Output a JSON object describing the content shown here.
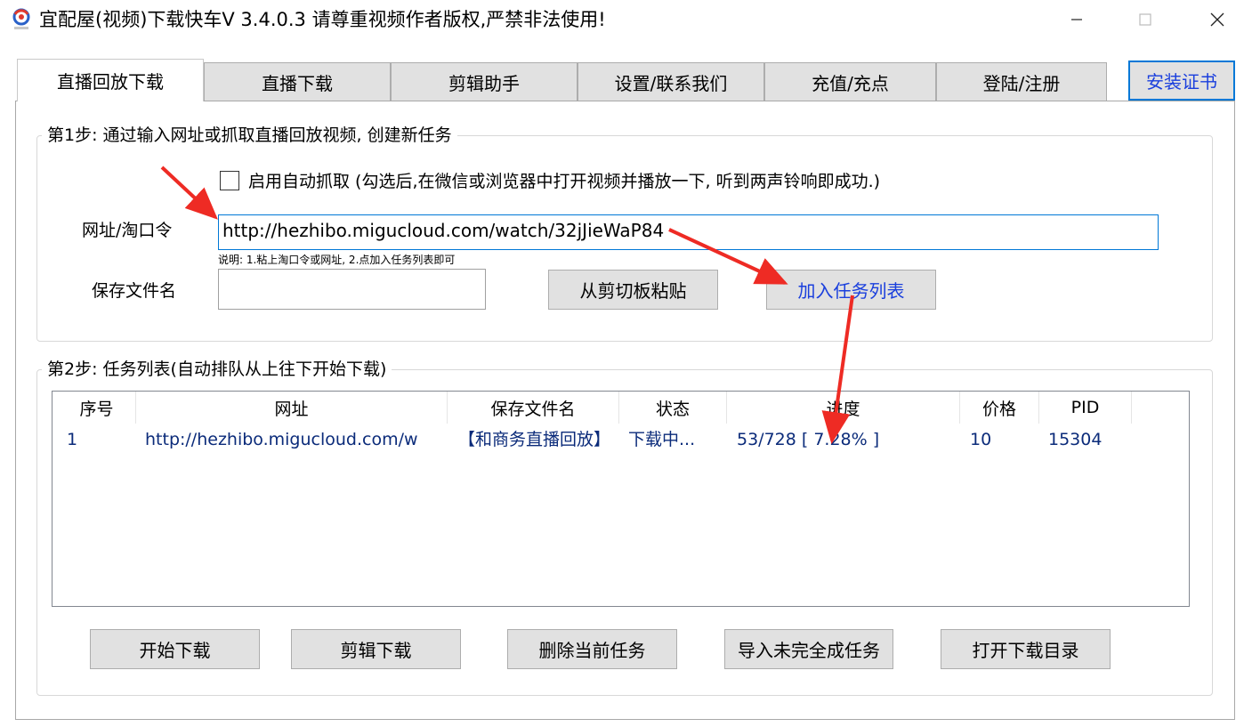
{
  "window": {
    "title": "宜配屋(视频)下载快车V 3.4.0.3 请尊重视频作者版权,严禁非法使用!",
    "minimize_icon": "minimize-icon",
    "maximize_icon": "maximize-icon",
    "close_icon": "close-icon"
  },
  "tabs": [
    {
      "label": "直播回放下载",
      "active": true
    },
    {
      "label": "直播下载"
    },
    {
      "label": "剪辑助手"
    },
    {
      "label": "设置/联系我们"
    },
    {
      "label": "充值/充点"
    },
    {
      "label": "登陆/注册"
    }
  ],
  "cert_button": "安装证书",
  "step1": {
    "legend": "第1步: 通过输入网址或抓取直播回放视频, 创建新任务",
    "auto_capture_label": "启用自动抓取 (勾选后,在微信或浏览器中打开视频并播放一下, 听到两声铃响即成功.)",
    "auto_capture_checked": false,
    "url_label": "网址/淘口令",
    "url_value": "http://hezhibo.migucloud.com/watch/32jJieWaP84",
    "hint": "说明: 1.粘上淘口令或网址, 2.点加入任务列表即可",
    "filename_label": "保存文件名",
    "filename_value": "",
    "paste_button": "从剪切板粘贴",
    "add_button": "加入任务列表"
  },
  "step2": {
    "legend": "第2步: 任务列表(自动排队从上往下开始下载)",
    "columns": [
      "序号",
      "网址",
      "保存文件名",
      "状态",
      "进度",
      "价格",
      "PID"
    ],
    "rows": [
      {
        "index": "1",
        "url": "http://hezhibo.migucloud.com/w",
        "filename": "【和商务直播回放】",
        "status": "下载中...",
        "progress": "53/728 [ 7.28% ]",
        "price": "10",
        "pid": "15304"
      }
    ],
    "buttons": [
      "开始下载",
      "剪辑下载",
      "删除当前任务",
      "导入未完全成任务",
      "打开下载目录"
    ]
  },
  "colors": {
    "accent": "#0078d7",
    "link_text": "#1a3fdd",
    "list_text": "#0b2b7a",
    "annotation_arrow": "#ee2b24"
  }
}
